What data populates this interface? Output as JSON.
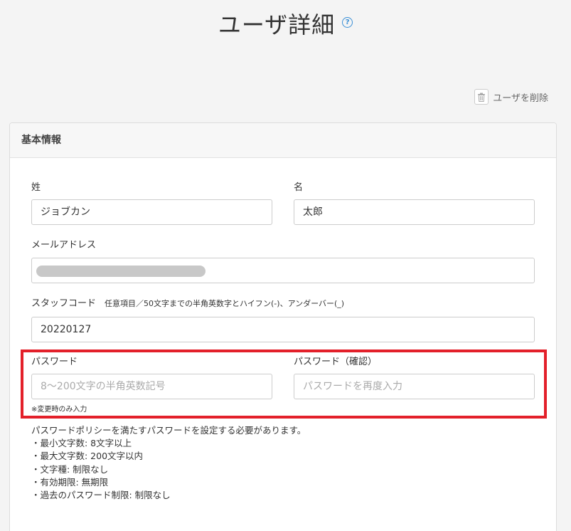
{
  "header": {
    "title": "ユーザ詳細",
    "help_icon": "?"
  },
  "toolbar": {
    "delete_label": "ユーザを削除",
    "delete_icon": "trash-icon"
  },
  "card": {
    "title": "基本情報"
  },
  "form": {
    "last_name": {
      "label": "姓",
      "value": "ジョブカン"
    },
    "first_name": {
      "label": "名",
      "value": "太郎"
    },
    "email": {
      "label": "メールアドレス",
      "value": ""
    },
    "staff_code": {
      "label": "スタッフコード",
      "hint": "任意項目／50文字までの半角英数字とハイフン(-)、アンダーバー(_)",
      "value": "20220127"
    },
    "password": {
      "label": "パスワード",
      "placeholder": "8〜200文字の半角英数記号",
      "note": "※変更時のみ入力"
    },
    "password_confirm": {
      "label": "パスワード（確認）",
      "placeholder": "パスワードを再度入力"
    }
  },
  "policy": {
    "intro": "パスワードポリシーを満たすパスワードを設定する必要があります。",
    "items": [
      "・最小文字数: 8文字以上",
      "・最大文字数: 200文字以内",
      "・文字種: 制限なし",
      "・有効期限: 無期限",
      "・過去のパスワード制限: 制限なし"
    ]
  },
  "colors": {
    "highlight": "#e3202a",
    "help_icon": "#3a8fd6"
  }
}
